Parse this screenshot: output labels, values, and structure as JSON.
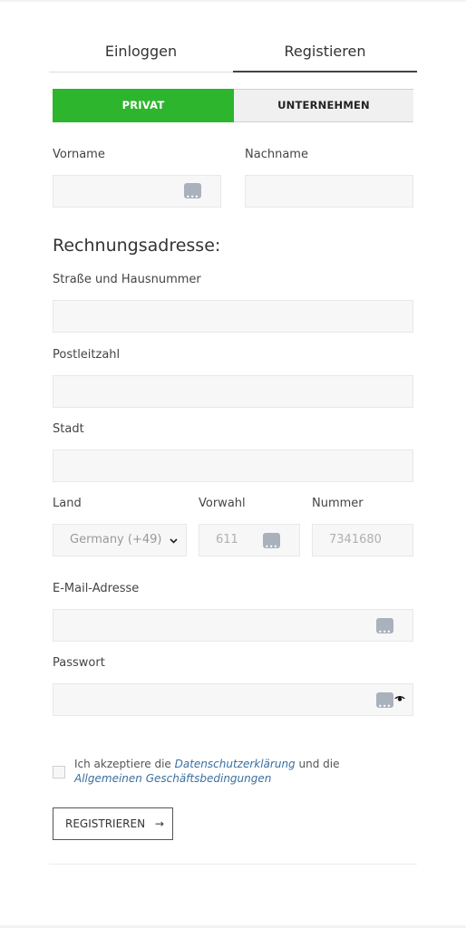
{
  "tabs": {
    "login": "Einloggen",
    "register": "Registieren"
  },
  "account_type": {
    "private": "PRIVAT",
    "company": "UNTERNEHMEN"
  },
  "fields": {
    "firstname_label": "Vorname",
    "lastname_label": "Nachname",
    "billing_heading": "Rechnungsadresse:",
    "street_label": "Straße und Hausnummer",
    "zip_label": "Postleitzahl",
    "city_label": "Stadt",
    "country_label": "Land",
    "country_value": "Germany (+49)",
    "areacode_label": "Vorwahl",
    "areacode_placeholder": "611",
    "number_label": "Nummer",
    "number_placeholder": "7341680",
    "email_label": "E-Mail-Adresse",
    "password_label": "Passwort"
  },
  "consent": {
    "prefix": "Ich akzeptiere die ",
    "privacy_link": "Datenschutzerklärung",
    "middle": " und die ",
    "terms_link": "Allgemeinen Geschäftsbedingungen"
  },
  "submit": {
    "label": "REGISTRIEREN",
    "arrow": "→"
  },
  "colors": {
    "accent": "#2db52d",
    "link": "#3a6fa0"
  },
  "icons": [
    "autofill-key-icon",
    "chevron-down-icon",
    "eye-icon",
    "arrow-right-icon"
  ]
}
